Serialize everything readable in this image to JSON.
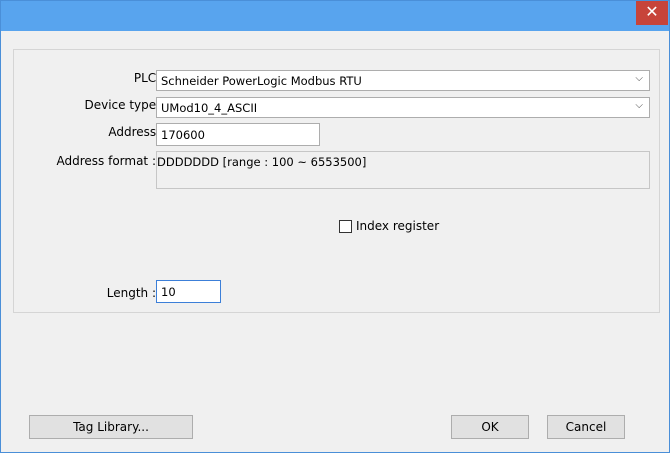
{
  "window": {
    "close_glyph": "✕"
  },
  "form": {
    "plc_label": "PLC :",
    "plc_value": "Schneider PowerLogic Modbus RTU",
    "device_type_label": "Device type :",
    "device_type_value": "UMod10_4_ASCII",
    "address_label": "Address :",
    "address_value": "170600",
    "address_format_label": "Address format :",
    "address_format_value": "DDDDDDD [range : 100 ~ 6553500]",
    "index_register_label": "Index register",
    "index_register_checked": false,
    "length_label": "Length :",
    "length_value": "10"
  },
  "footer": {
    "tag_library_label": "Tag Library...",
    "ok_label": "OK",
    "cancel_label": "Cancel"
  },
  "icons": {
    "dropdown": "chevron-down-icon",
    "close": "close-icon"
  }
}
